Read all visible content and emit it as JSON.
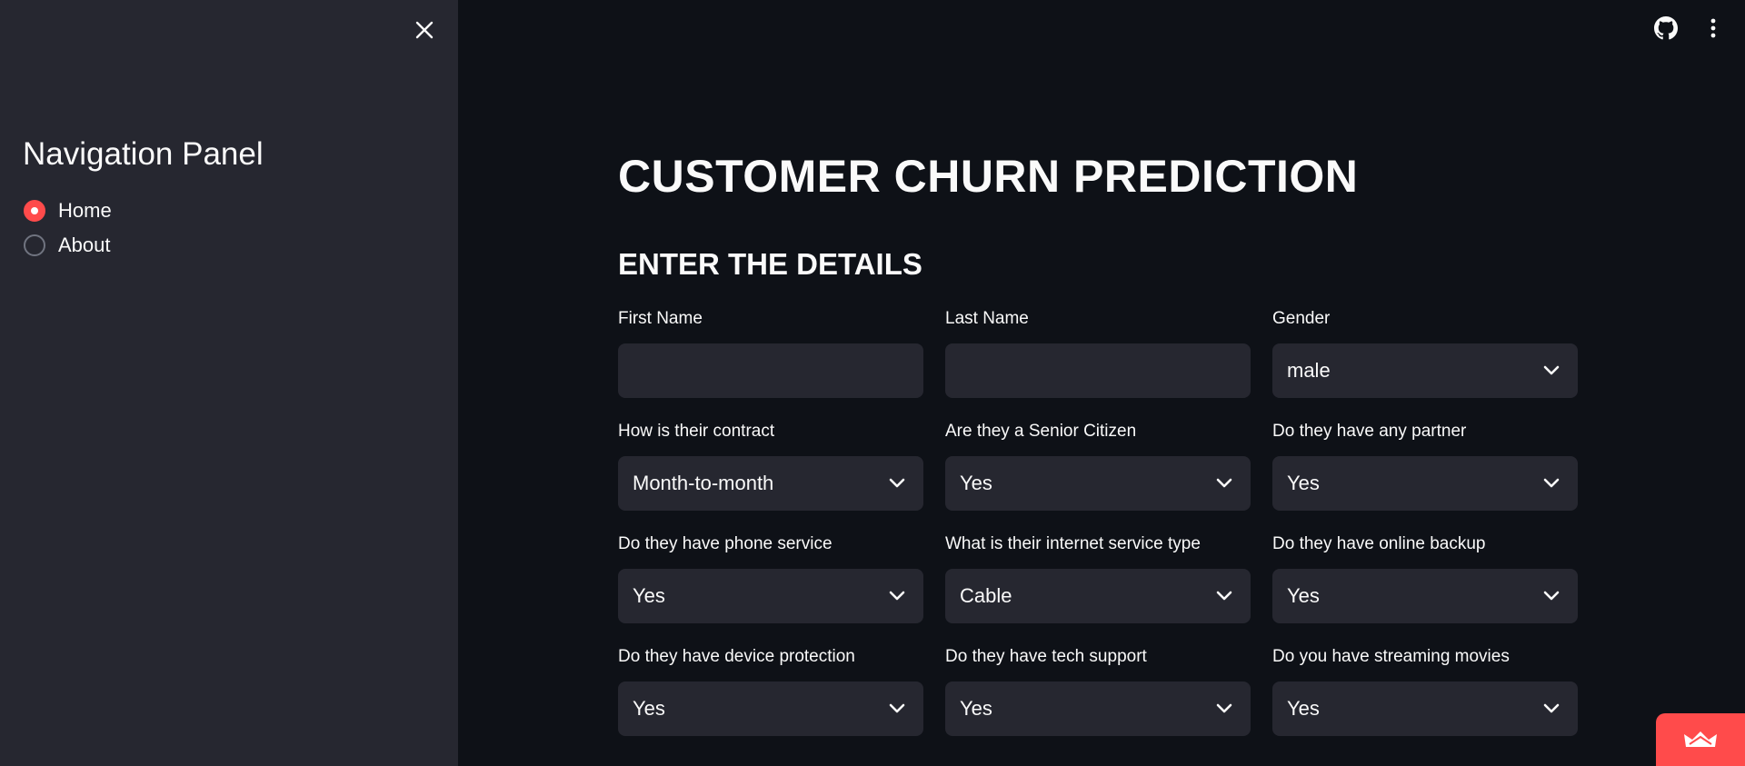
{
  "sidebar": {
    "title": "Navigation Panel",
    "nav_options": [
      {
        "label": "Home",
        "selected": true
      },
      {
        "label": "About",
        "selected": false
      }
    ]
  },
  "main": {
    "title": "CUSTOMER CHURN PREDICTION",
    "section_title": "ENTER THE DETAILS",
    "fields": [
      {
        "label": "First Name",
        "type": "text",
        "value": ""
      },
      {
        "label": "Last Name",
        "type": "text",
        "value": ""
      },
      {
        "label": "Gender",
        "type": "select",
        "value": "male"
      },
      {
        "label": "How is their contract",
        "type": "select",
        "value": "Month-to-month"
      },
      {
        "label": "Are they a Senior Citizen",
        "type": "select",
        "value": "Yes"
      },
      {
        "label": "Do they have any partner",
        "type": "select",
        "value": "Yes"
      },
      {
        "label": "Do they have phone service",
        "type": "select",
        "value": "Yes"
      },
      {
        "label": "What is their internet service type",
        "type": "select",
        "value": "Cable"
      },
      {
        "label": "Do they have online backup",
        "type": "select",
        "value": "Yes"
      },
      {
        "label": "Do they have device protection",
        "type": "select",
        "value": "Yes"
      },
      {
        "label": "Do they have tech support",
        "type": "select",
        "value": "Yes"
      },
      {
        "label": "Do you have streaming movies",
        "type": "select",
        "value": "Yes"
      }
    ]
  },
  "colors": {
    "background": "#0e1117",
    "sidebar": "#262730",
    "input": "#262730",
    "accent": "#ff4b4b",
    "text": "#fafafa"
  },
  "icons": {
    "sidebar_close": "close-icon",
    "github": "github-icon",
    "menu": "kebab-menu-icon",
    "badge": "crown-icon"
  }
}
